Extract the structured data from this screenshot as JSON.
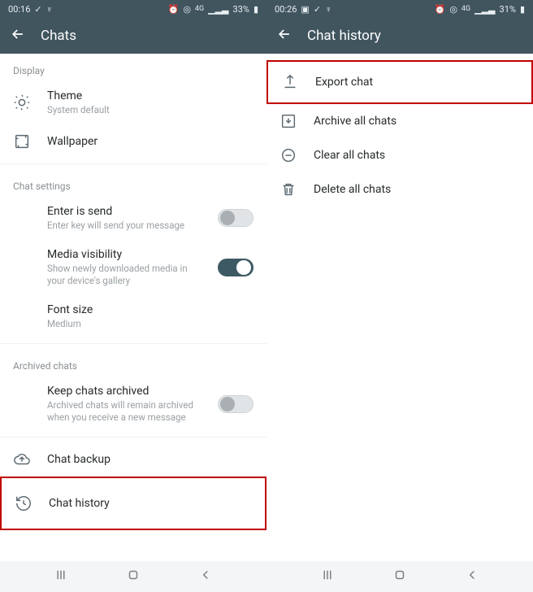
{
  "left": {
    "status": {
      "time": "00:16",
      "battery": "33%"
    },
    "appbar": {
      "title": "Chats"
    },
    "sections": {
      "display": {
        "header": "Display",
        "theme": {
          "title": "Theme",
          "sub": "System default"
        },
        "wallpaper": {
          "title": "Wallpaper"
        }
      },
      "chat_settings": {
        "header": "Chat settings",
        "enter_send": {
          "title": "Enter is send",
          "sub": "Enter key will send your message",
          "on": false
        },
        "media_vis": {
          "title": "Media visibility",
          "sub": "Show newly downloaded media in your device's gallery",
          "on": true
        },
        "font_size": {
          "title": "Font size",
          "sub": "Medium"
        }
      },
      "archived": {
        "header": "Archived chats",
        "keep": {
          "title": "Keep chats archived",
          "sub": "Archived chats will remain archived when you receive a new message",
          "on": false
        }
      },
      "backup": {
        "title": "Chat backup"
      },
      "history": {
        "title": "Chat history"
      }
    }
  },
  "right": {
    "status": {
      "time": "00:26",
      "battery": "31%"
    },
    "appbar": {
      "title": "Chat history"
    },
    "items": {
      "export": {
        "title": "Export chat"
      },
      "archive": {
        "title": "Archive all chats"
      },
      "clear": {
        "title": "Clear all chats"
      },
      "delete": {
        "title": "Delete all chats"
      }
    }
  }
}
